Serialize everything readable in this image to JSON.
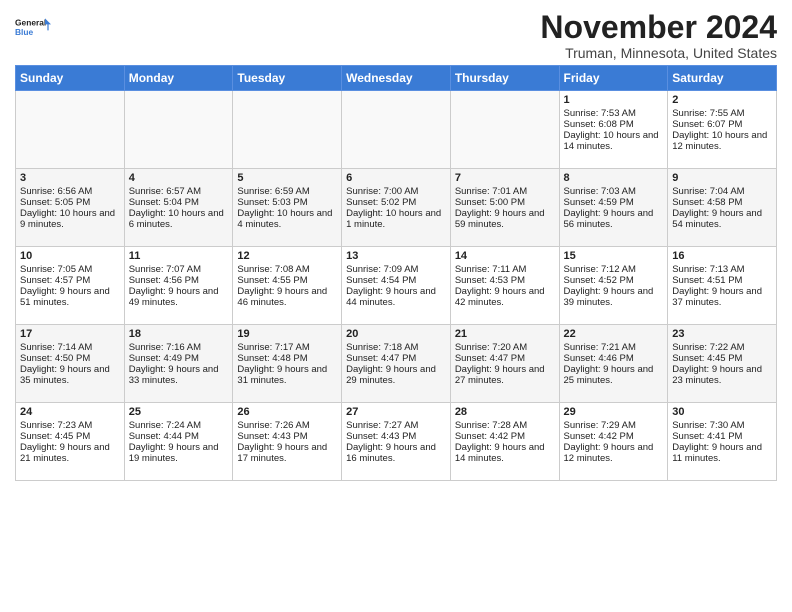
{
  "header": {
    "logo_line1": "General",
    "logo_line2": "Blue",
    "month_title": "November 2024",
    "location": "Truman, Minnesota, United States"
  },
  "days_of_week": [
    "Sunday",
    "Monday",
    "Tuesday",
    "Wednesday",
    "Thursday",
    "Friday",
    "Saturday"
  ],
  "weeks": [
    [
      {
        "day": "",
        "info": ""
      },
      {
        "day": "",
        "info": ""
      },
      {
        "day": "",
        "info": ""
      },
      {
        "day": "",
        "info": ""
      },
      {
        "day": "",
        "info": ""
      },
      {
        "day": "1",
        "info": "Sunrise: 7:53 AM\nSunset: 6:08 PM\nDaylight: 10 hours and 14 minutes."
      },
      {
        "day": "2",
        "info": "Sunrise: 7:55 AM\nSunset: 6:07 PM\nDaylight: 10 hours and 12 minutes."
      }
    ],
    [
      {
        "day": "3",
        "info": "Sunrise: 6:56 AM\nSunset: 5:05 PM\nDaylight: 10 hours and 9 minutes."
      },
      {
        "day": "4",
        "info": "Sunrise: 6:57 AM\nSunset: 5:04 PM\nDaylight: 10 hours and 6 minutes."
      },
      {
        "day": "5",
        "info": "Sunrise: 6:59 AM\nSunset: 5:03 PM\nDaylight: 10 hours and 4 minutes."
      },
      {
        "day": "6",
        "info": "Sunrise: 7:00 AM\nSunset: 5:02 PM\nDaylight: 10 hours and 1 minute."
      },
      {
        "day": "7",
        "info": "Sunrise: 7:01 AM\nSunset: 5:00 PM\nDaylight: 9 hours and 59 minutes."
      },
      {
        "day": "8",
        "info": "Sunrise: 7:03 AM\nSunset: 4:59 PM\nDaylight: 9 hours and 56 minutes."
      },
      {
        "day": "9",
        "info": "Sunrise: 7:04 AM\nSunset: 4:58 PM\nDaylight: 9 hours and 54 minutes."
      }
    ],
    [
      {
        "day": "10",
        "info": "Sunrise: 7:05 AM\nSunset: 4:57 PM\nDaylight: 9 hours and 51 minutes."
      },
      {
        "day": "11",
        "info": "Sunrise: 7:07 AM\nSunset: 4:56 PM\nDaylight: 9 hours and 49 minutes."
      },
      {
        "day": "12",
        "info": "Sunrise: 7:08 AM\nSunset: 4:55 PM\nDaylight: 9 hours and 46 minutes."
      },
      {
        "day": "13",
        "info": "Sunrise: 7:09 AM\nSunset: 4:54 PM\nDaylight: 9 hours and 44 minutes."
      },
      {
        "day": "14",
        "info": "Sunrise: 7:11 AM\nSunset: 4:53 PM\nDaylight: 9 hours and 42 minutes."
      },
      {
        "day": "15",
        "info": "Sunrise: 7:12 AM\nSunset: 4:52 PM\nDaylight: 9 hours and 39 minutes."
      },
      {
        "day": "16",
        "info": "Sunrise: 7:13 AM\nSunset: 4:51 PM\nDaylight: 9 hours and 37 minutes."
      }
    ],
    [
      {
        "day": "17",
        "info": "Sunrise: 7:14 AM\nSunset: 4:50 PM\nDaylight: 9 hours and 35 minutes."
      },
      {
        "day": "18",
        "info": "Sunrise: 7:16 AM\nSunset: 4:49 PM\nDaylight: 9 hours and 33 minutes."
      },
      {
        "day": "19",
        "info": "Sunrise: 7:17 AM\nSunset: 4:48 PM\nDaylight: 9 hours and 31 minutes."
      },
      {
        "day": "20",
        "info": "Sunrise: 7:18 AM\nSunset: 4:47 PM\nDaylight: 9 hours and 29 minutes."
      },
      {
        "day": "21",
        "info": "Sunrise: 7:20 AM\nSunset: 4:47 PM\nDaylight: 9 hours and 27 minutes."
      },
      {
        "day": "22",
        "info": "Sunrise: 7:21 AM\nSunset: 4:46 PM\nDaylight: 9 hours and 25 minutes."
      },
      {
        "day": "23",
        "info": "Sunrise: 7:22 AM\nSunset: 4:45 PM\nDaylight: 9 hours and 23 minutes."
      }
    ],
    [
      {
        "day": "24",
        "info": "Sunrise: 7:23 AM\nSunset: 4:45 PM\nDaylight: 9 hours and 21 minutes."
      },
      {
        "day": "25",
        "info": "Sunrise: 7:24 AM\nSunset: 4:44 PM\nDaylight: 9 hours and 19 minutes."
      },
      {
        "day": "26",
        "info": "Sunrise: 7:26 AM\nSunset: 4:43 PM\nDaylight: 9 hours and 17 minutes."
      },
      {
        "day": "27",
        "info": "Sunrise: 7:27 AM\nSunset: 4:43 PM\nDaylight: 9 hours and 16 minutes."
      },
      {
        "day": "28",
        "info": "Sunrise: 7:28 AM\nSunset: 4:42 PM\nDaylight: 9 hours and 14 minutes."
      },
      {
        "day": "29",
        "info": "Sunrise: 7:29 AM\nSunset: 4:42 PM\nDaylight: 9 hours and 12 minutes."
      },
      {
        "day": "30",
        "info": "Sunrise: 7:30 AM\nSunset: 4:41 PM\nDaylight: 9 hours and 11 minutes."
      }
    ]
  ]
}
